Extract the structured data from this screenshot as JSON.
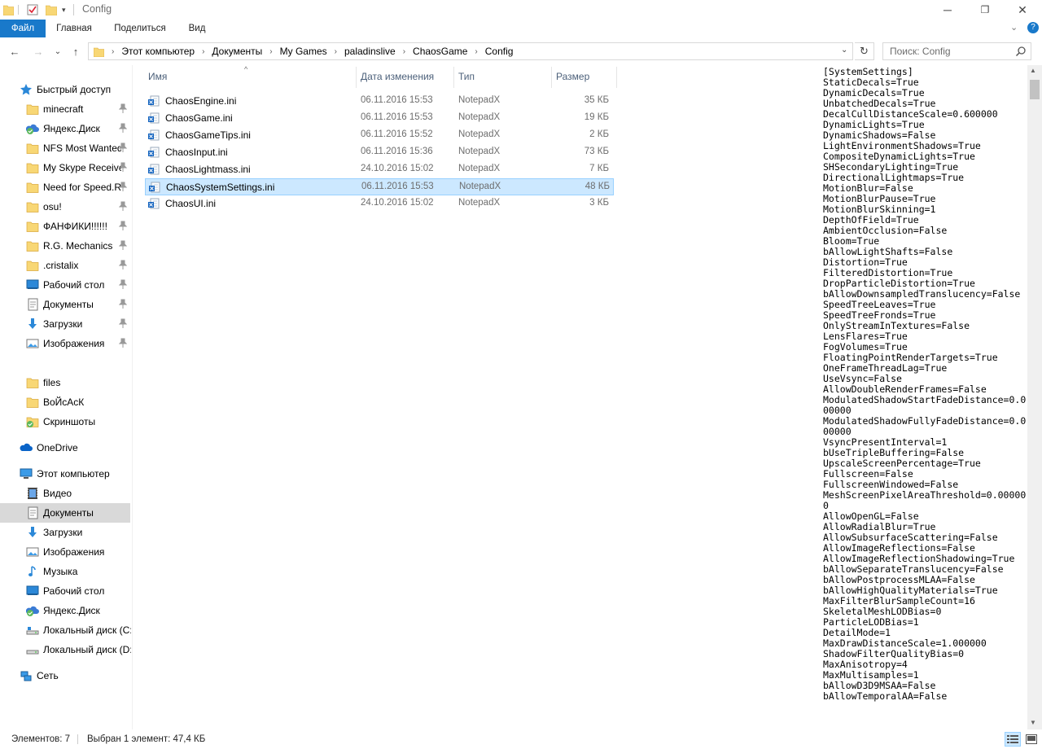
{
  "window": {
    "title": "Config",
    "controls": {
      "minimize": "─",
      "maximize": "❐",
      "close": "✕"
    }
  },
  "ribbon": {
    "tabs": [
      "Файл",
      "Главная",
      "Поделиться",
      "Вид"
    ],
    "expand_glyph": "⌄",
    "help_glyph": "?"
  },
  "navigation": {
    "back": "←",
    "forward": "→",
    "recent": "⌄",
    "up": "↑"
  },
  "address": {
    "breadcrumbs": [
      "Этот компьютер",
      "Документы",
      "My Games",
      "paladinslive",
      "ChaosGame",
      "Config"
    ],
    "refresh_glyph": "↻"
  },
  "search": {
    "placeholder": "Поиск: Config"
  },
  "nav_pane": {
    "quick_access_label": "Быстрый доступ",
    "quick_access": [
      {
        "label": "minecraft",
        "icon": "folder-icon",
        "pinned": true
      },
      {
        "label": "Яндекс.Диск",
        "icon": "yandex-disk-icon",
        "pinned": true
      },
      {
        "label": "NFS Most Wanted",
        "icon": "folder-icon",
        "pinned": true
      },
      {
        "label": "My Skype Received",
        "icon": "folder-icon",
        "pinned": true
      },
      {
        "label": "Need for Speed.Rivals",
        "icon": "folder-icon",
        "pinned": true
      },
      {
        "label": "osu!",
        "icon": "folder-icon",
        "pinned": true
      },
      {
        "label": "ФАНФИКИ!!!!!!",
        "icon": "folder-icon",
        "pinned": true
      },
      {
        "label": "R.G. Mechanics",
        "icon": "folder-icon",
        "pinned": true
      },
      {
        "label": ".cristalix",
        "icon": "folder-icon",
        "pinned": true
      },
      {
        "label": "Рабочий стол",
        "icon": "desktop-icon",
        "pinned": true
      },
      {
        "label": "Документы",
        "icon": "documents-icon",
        "pinned": true
      },
      {
        "label": "Загрузки",
        "icon": "downloads-icon",
        "pinned": true
      },
      {
        "label": "Изображения",
        "icon": "pictures-icon",
        "pinned": true
      }
    ],
    "recent": [
      {
        "label": "files",
        "icon": "folder-icon"
      },
      {
        "label": "ВоЙсАсК",
        "icon": "folder-icon"
      },
      {
        "label": "Скриншоты",
        "icon": "yandex-screenshots-icon"
      }
    ],
    "onedrive_label": "OneDrive",
    "this_pc_label": "Этот компьютер",
    "this_pc": [
      {
        "label": "Видео",
        "icon": "video-icon"
      },
      {
        "label": "Документы",
        "icon": "documents-icon",
        "selected": true
      },
      {
        "label": "Загрузки",
        "icon": "downloads-icon"
      },
      {
        "label": "Изображения",
        "icon": "pictures-icon"
      },
      {
        "label": "Музыка",
        "icon": "music-icon"
      },
      {
        "label": "Рабочий стол",
        "icon": "desktop-icon"
      },
      {
        "label": "Яндекс.Диск",
        "icon": "yandex-disk-icon"
      },
      {
        "label": "Локальный диск (C:)",
        "icon": "local-disk-c-icon"
      },
      {
        "label": "Локальный диск (D:)",
        "icon": "local-disk-d-icon"
      }
    ],
    "network_label": "Сеть"
  },
  "file_list": {
    "columns": {
      "name": "Имя",
      "date": "Дата изменения",
      "type": "Тип",
      "size": "Размер"
    },
    "sort_glyph": "^",
    "files": [
      {
        "name": "ChaosEngine.ini",
        "date": "06.11.2016 15:53",
        "type": "NotepadX",
        "size": "35 КБ"
      },
      {
        "name": "ChaosGame.ini",
        "date": "06.11.2016 15:53",
        "type": "NotepadX",
        "size": "19 КБ"
      },
      {
        "name": "ChaosGameTips.ini",
        "date": "06.11.2016 15:52",
        "type": "NotepadX",
        "size": "2 КБ"
      },
      {
        "name": "ChaosInput.ini",
        "date": "06.11.2016 15:36",
        "type": "NotepadX",
        "size": "73 КБ"
      },
      {
        "name": "ChaosLightmass.ini",
        "date": "24.10.2016 15:02",
        "type": "NotepadX",
        "size": "7 КБ"
      },
      {
        "name": "ChaosSystemSettings.ini",
        "date": "06.11.2016 15:53",
        "type": "NotepadX",
        "size": "48 КБ",
        "selected": true
      },
      {
        "name": "ChaosUI.ini",
        "date": "24.10.2016 15:02",
        "type": "NotepadX",
        "size": "3 КБ"
      }
    ]
  },
  "preview": {
    "content": "[SystemSettings]\nStaticDecals=True\nDynamicDecals=True\nUnbatchedDecals=True\nDecalCullDistanceScale=0.600000\nDynamicLights=True\nDynamicShadows=False\nLightEnvironmentShadows=True\nCompositeDynamicLights=True\nSHSecondaryLighting=True\nDirectionalLightmaps=True\nMotionBlur=False\nMotionBlurPause=True\nMotionBlurSkinning=1\nDepthOfField=True\nAmbientOcclusion=False\nBloom=True\nbAllowLightShafts=False\nDistortion=True\nFilteredDistortion=True\nDropParticleDistortion=True\nbAllowDownsampledTranslucency=False\nSpeedTreeLeaves=True\nSpeedTreeFronds=True\nOnlyStreamInTextures=False\nLensFlares=True\nFogVolumes=True\nFloatingPointRenderTargets=True\nOneFrameThreadLag=True\nUseVsync=False\nAllowDoubleRenderFrames=False\nModulatedShadowStartFadeDistance=0.000000\nModulatedShadowFullyFadeDistance=0.000000\nVsyncPresentInterval=1\nbUseTripleBuffering=False\nUpscaleScreenPercentage=True\nFullscreen=False\nFullscreenWindowed=False\nMeshScreenPixelAreaThreshold=0.000000\nAllowOpenGL=False\nAllowRadialBlur=True\nAllowSubsurfaceScattering=False\nAllowImageReflections=False\nAllowImageReflectionShadowing=True\nbAllowSeparateTranslucency=False\nbAllowPostprocessMLAA=False\nbAllowHighQualityMaterials=True\nMaxFilterBlurSampleCount=16\nSkeletalMeshLODBias=0\nParticleLODBias=1\nDetailMode=1\nMaxDrawDistanceScale=1.000000\nShadowFilterQualityBias=0\nMaxAnisotropy=4\nMaxMultisamples=1\nbAllowD3D9MSAA=False\nbAllowTemporalAA=False",
    "scroll_up": "▲",
    "scroll_down": "▼"
  },
  "status": {
    "items_count": "Элементов: 7",
    "selection": "Выбран 1 элемент: 47,4 КБ"
  },
  "colors": {
    "accent": "#1979ca",
    "selection_bg": "#cce8ff",
    "selection_border": "#99d1ff",
    "folder": "#f8d775",
    "header_text": "#4c607a"
  }
}
